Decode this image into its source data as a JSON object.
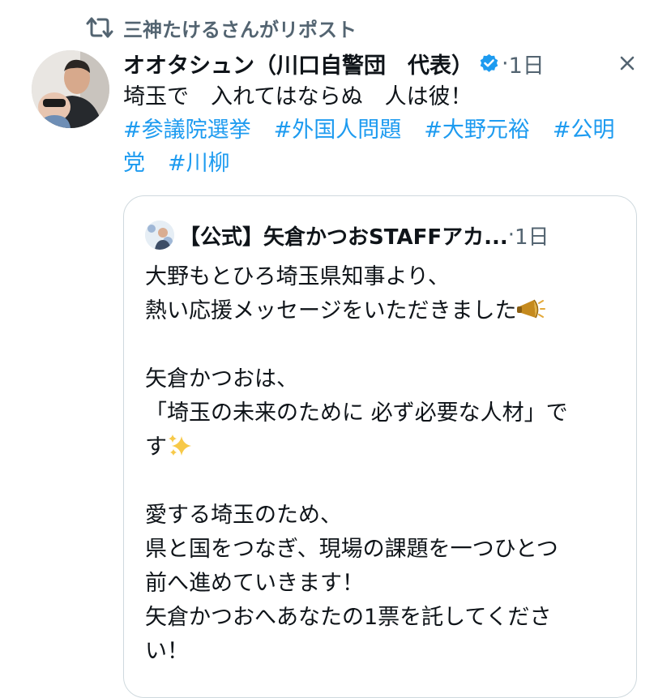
{
  "repost": {
    "icon": "repost-icon",
    "text": "三神たけるさんがリポスト"
  },
  "tweet": {
    "author_name": "オオタシュン（川口自警団　代表）",
    "verified_icon": "verified-badge-icon",
    "separator": "·",
    "time": "1日",
    "more_icon": "more-options-icon",
    "text": "埼玉で　入れてはならぬ　人は彼！",
    "hashtags": [
      "#参議院選挙",
      "#外国人問題",
      "#大野元裕",
      "#公明党",
      "#川柳"
    ]
  },
  "quote": {
    "author_name": "【公式】矢倉かつおSTAFFアカ...",
    "separator": "·",
    "time": "1日",
    "lines": [
      "大野もとひろ埼玉県知事より、",
      "熱い応援メッセージをいただきました",
      "",
      "矢倉かつおは、",
      "「埼玉の未来のために 必ず必要な人材」で",
      "す",
      "",
      "愛する埼玉のため、",
      "県と国をつなぎ、現場の課題を一つひとつ",
      "前へ進めていきます！",
      "矢倉かつおへあなたの1票を託してくださ",
      "い！"
    ],
    "emojis": [
      "megaphone-icon",
      "sparkles-icon"
    ]
  },
  "colors": {
    "link": "#1d9bf0",
    "secondary_text": "#536471",
    "border": "#cfd9de",
    "verified": "#1d9bf0"
  }
}
